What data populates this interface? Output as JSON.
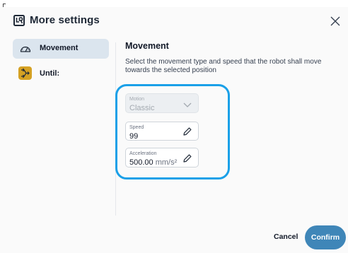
{
  "dialog": {
    "title": "More settings",
    "colors": {
      "accent": "#3f86b8",
      "highlight": "#1aa0e8",
      "until_icon_bg": "#d5a123"
    }
  },
  "sidebar": {
    "items": [
      {
        "label": "Movement",
        "icon": "gauge-icon",
        "active": true
      },
      {
        "label": "Until:",
        "icon": "branch-arrows-icon",
        "active": false
      }
    ]
  },
  "main": {
    "title": "Movement",
    "description": "Select the movement type and speed that the robot shall move towards the selected position",
    "fields": {
      "motion": {
        "label": "Motion",
        "value": "Classic",
        "icon": "chevron-down-icon",
        "disabled": true
      },
      "speed": {
        "label": "Speed",
        "value": "99",
        "icon": "pencil-icon"
      },
      "acceleration": {
        "label": "Acceleration",
        "value": "500.00",
        "unit": "mm/s²",
        "icon": "pencil-icon"
      }
    }
  },
  "footer": {
    "cancel_label": "Cancel",
    "confirm_label": "Confirm"
  }
}
